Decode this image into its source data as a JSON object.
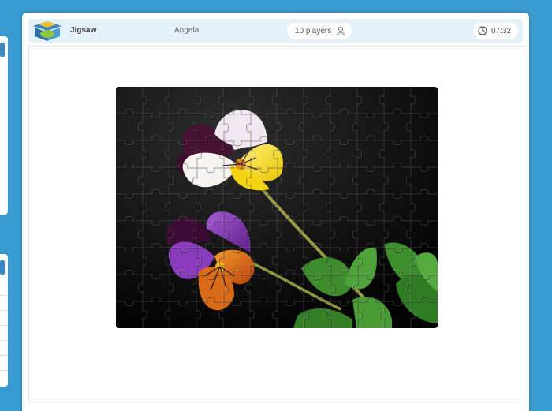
{
  "header": {
    "app_title": "Jigsaw",
    "username": "Angela",
    "players": "10 players",
    "timer": "07:32",
    "logo_icon": "box-logo-icon",
    "players_icon": "person-icon",
    "timer_icon": "clock-icon"
  },
  "puzzle": {
    "image_subject": "purple yellow and white pansy flowers on black",
    "grid_columns": 12,
    "grid_rows": 9
  },
  "colors": {
    "background": "#3a9bd0",
    "topbar": "#e4f1f9",
    "accent": "#3a86c2"
  }
}
